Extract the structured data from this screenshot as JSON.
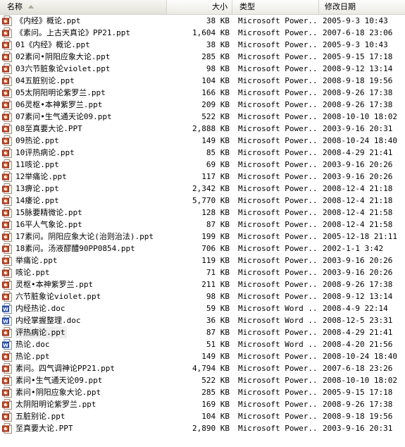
{
  "header": {
    "name": "名称",
    "size": "大小",
    "type": "类型",
    "date": "修改日期"
  },
  "colors": {
    "ppt": "#c8462a",
    "doc": "#2a56b8"
  },
  "files": [
    {
      "name": "《内经》概论.ppt",
      "size": "38 KB",
      "type": "Microsoft Power...",
      "date": "2005-9-3 10:43",
      "kind": "ppt"
    },
    {
      "name": "《素问。上古天真论》PP21.ppt",
      "size": "1,604 KB",
      "type": "Microsoft Power...",
      "date": "2007-6-18 23:06",
      "kind": "ppt"
    },
    {
      "name": "01《内经》概论.ppt",
      "size": "38 KB",
      "type": "Microsoft Power...",
      "date": "2005-9-3 10:43",
      "kind": "ppt"
    },
    {
      "name": "02素问•阴阳应象大论.ppt",
      "size": "285 KB",
      "type": "Microsoft Power...",
      "date": "2005-9-15 17:18",
      "kind": "ppt"
    },
    {
      "name": "03六节脏象论violet.ppt",
      "size": "98 KB",
      "type": "Microsoft Power...",
      "date": "2008-9-12 13:14",
      "kind": "ppt"
    },
    {
      "name": "04五脏别论.ppt",
      "size": "104 KB",
      "type": "Microsoft Power...",
      "date": "2008-9-18 19:56",
      "kind": "ppt"
    },
    {
      "name": "05太阴阳明论紫罗兰.ppt",
      "size": "166 KB",
      "type": "Microsoft Power...",
      "date": "2008-9-26 17:38",
      "kind": "ppt"
    },
    {
      "name": "06灵枢•本神紫罗兰.ppt",
      "size": "209 KB",
      "type": "Microsoft Power...",
      "date": "2008-9-26 17:38",
      "kind": "ppt"
    },
    {
      "name": "07素问•生气通天论09.ppt",
      "size": "522 KB",
      "type": "Microsoft Power...",
      "date": "2008-10-10 18:02",
      "kind": "ppt"
    },
    {
      "name": "08至真要大论.PPT",
      "size": "2,888 KB",
      "type": "Microsoft Power...",
      "date": "2003-9-16 20:31",
      "kind": "ppt"
    },
    {
      "name": "09热论.ppt",
      "size": "149 KB",
      "type": "Microsoft Power...",
      "date": "2008-10-24 18:40",
      "kind": "ppt"
    },
    {
      "name": "10评热病论.ppt",
      "size": "85 KB",
      "type": "Microsoft Power...",
      "date": "2008-4-29 21:41",
      "kind": "ppt"
    },
    {
      "name": "11咳论.ppt",
      "size": "69 KB",
      "type": "Microsoft Power...",
      "date": "2003-9-16 20:26",
      "kind": "ppt"
    },
    {
      "name": "12举痛论.ppt",
      "size": "117 KB",
      "type": "Microsoft Power...",
      "date": "2003-9-16 20:26",
      "kind": "ppt"
    },
    {
      "name": "13痹论.ppt",
      "size": "2,342 KB",
      "type": "Microsoft Power...",
      "date": "2008-12-4 21:18",
      "kind": "ppt"
    },
    {
      "name": "14痿论.ppt",
      "size": "5,770 KB",
      "type": "Microsoft Power...",
      "date": "2008-12-4 21:18",
      "kind": "ppt"
    },
    {
      "name": "15脉要精微论.ppt",
      "size": "128 KB",
      "type": "Microsoft Power...",
      "date": "2008-12-4 21:58",
      "kind": "ppt"
    },
    {
      "name": "16平人气象论.ppt",
      "size": "87 KB",
      "type": "Microsoft Power...",
      "date": "2008-12-4 21:58",
      "kind": "ppt"
    },
    {
      "name": "17素问。阴阳应象大论(治则治法).ppt",
      "size": "199 KB",
      "type": "Microsoft Power...",
      "date": "2005-12-18 21:11",
      "kind": "ppt"
    },
    {
      "name": "18素问。汤液醪醴90PP0854.ppt",
      "size": "706 KB",
      "type": "Microsoft Power...",
      "date": "2002-1-1 3:42",
      "kind": "ppt"
    },
    {
      "name": "举痛论.ppt",
      "size": "119 KB",
      "type": "Microsoft Power...",
      "date": "2003-9-16 20:26",
      "kind": "ppt"
    },
    {
      "name": "咳论.ppt",
      "size": "71 KB",
      "type": "Microsoft Power...",
      "date": "2003-9-16 20:26",
      "kind": "ppt"
    },
    {
      "name": "灵枢•本神紫罗兰.ppt",
      "size": "211 KB",
      "type": "Microsoft Power...",
      "date": "2008-9-26 17:38",
      "kind": "ppt"
    },
    {
      "name": "六节脏象论violet.ppt",
      "size": "98 KB",
      "type": "Microsoft Power...",
      "date": "2008-9-12 13:14",
      "kind": "ppt"
    },
    {
      "name": "内经热论.doc",
      "size": "59 KB",
      "type": "Microsoft Word ...",
      "date": "2008-4-9 22:14",
      "kind": "doc"
    },
    {
      "name": "内经掌握整理.doc",
      "size": "36 KB",
      "type": "Microsoft Word ...",
      "date": "2008-12-5 23:31",
      "kind": "doc"
    },
    {
      "name": "评热病论.ppt",
      "size": "87 KB",
      "type": "Microsoft Power...",
      "date": "2008-4-29 21:41",
      "kind": "ppt",
      "hot": true
    },
    {
      "name": "热论.doc",
      "size": "51 KB",
      "type": "Microsoft Word ...",
      "date": "2008-4-20 21:56",
      "kind": "doc"
    },
    {
      "name": "热论.ppt",
      "size": "149 KB",
      "type": "Microsoft Power...",
      "date": "2008-10-24 18:40",
      "kind": "ppt"
    },
    {
      "name": "素问。四气调神论PP21.ppt",
      "size": "4,794 KB",
      "type": "Microsoft Power...",
      "date": "2007-6-18 23:26",
      "kind": "ppt"
    },
    {
      "name": "素问•生气通天论09.ppt",
      "size": "522 KB",
      "type": "Microsoft Power...",
      "date": "2008-10-10 18:02",
      "kind": "ppt"
    },
    {
      "name": "素问•阴阳应象大论.ppt",
      "size": "285 KB",
      "type": "Microsoft Power...",
      "date": "2005-9-15 17:18",
      "kind": "ppt"
    },
    {
      "name": "太阴阳明论紫罗兰.ppt",
      "size": "169 KB",
      "type": "Microsoft Power...",
      "date": "2008-9-26 17:38",
      "kind": "ppt"
    },
    {
      "name": "五脏别论.ppt",
      "size": "104 KB",
      "type": "Microsoft Power...",
      "date": "2008-9-18 19:56",
      "kind": "ppt"
    },
    {
      "name": "至真要大论.PPT",
      "size": "2,890 KB",
      "type": "Microsoft Power...",
      "date": "2003-9-16 20:31",
      "kind": "ppt"
    }
  ]
}
